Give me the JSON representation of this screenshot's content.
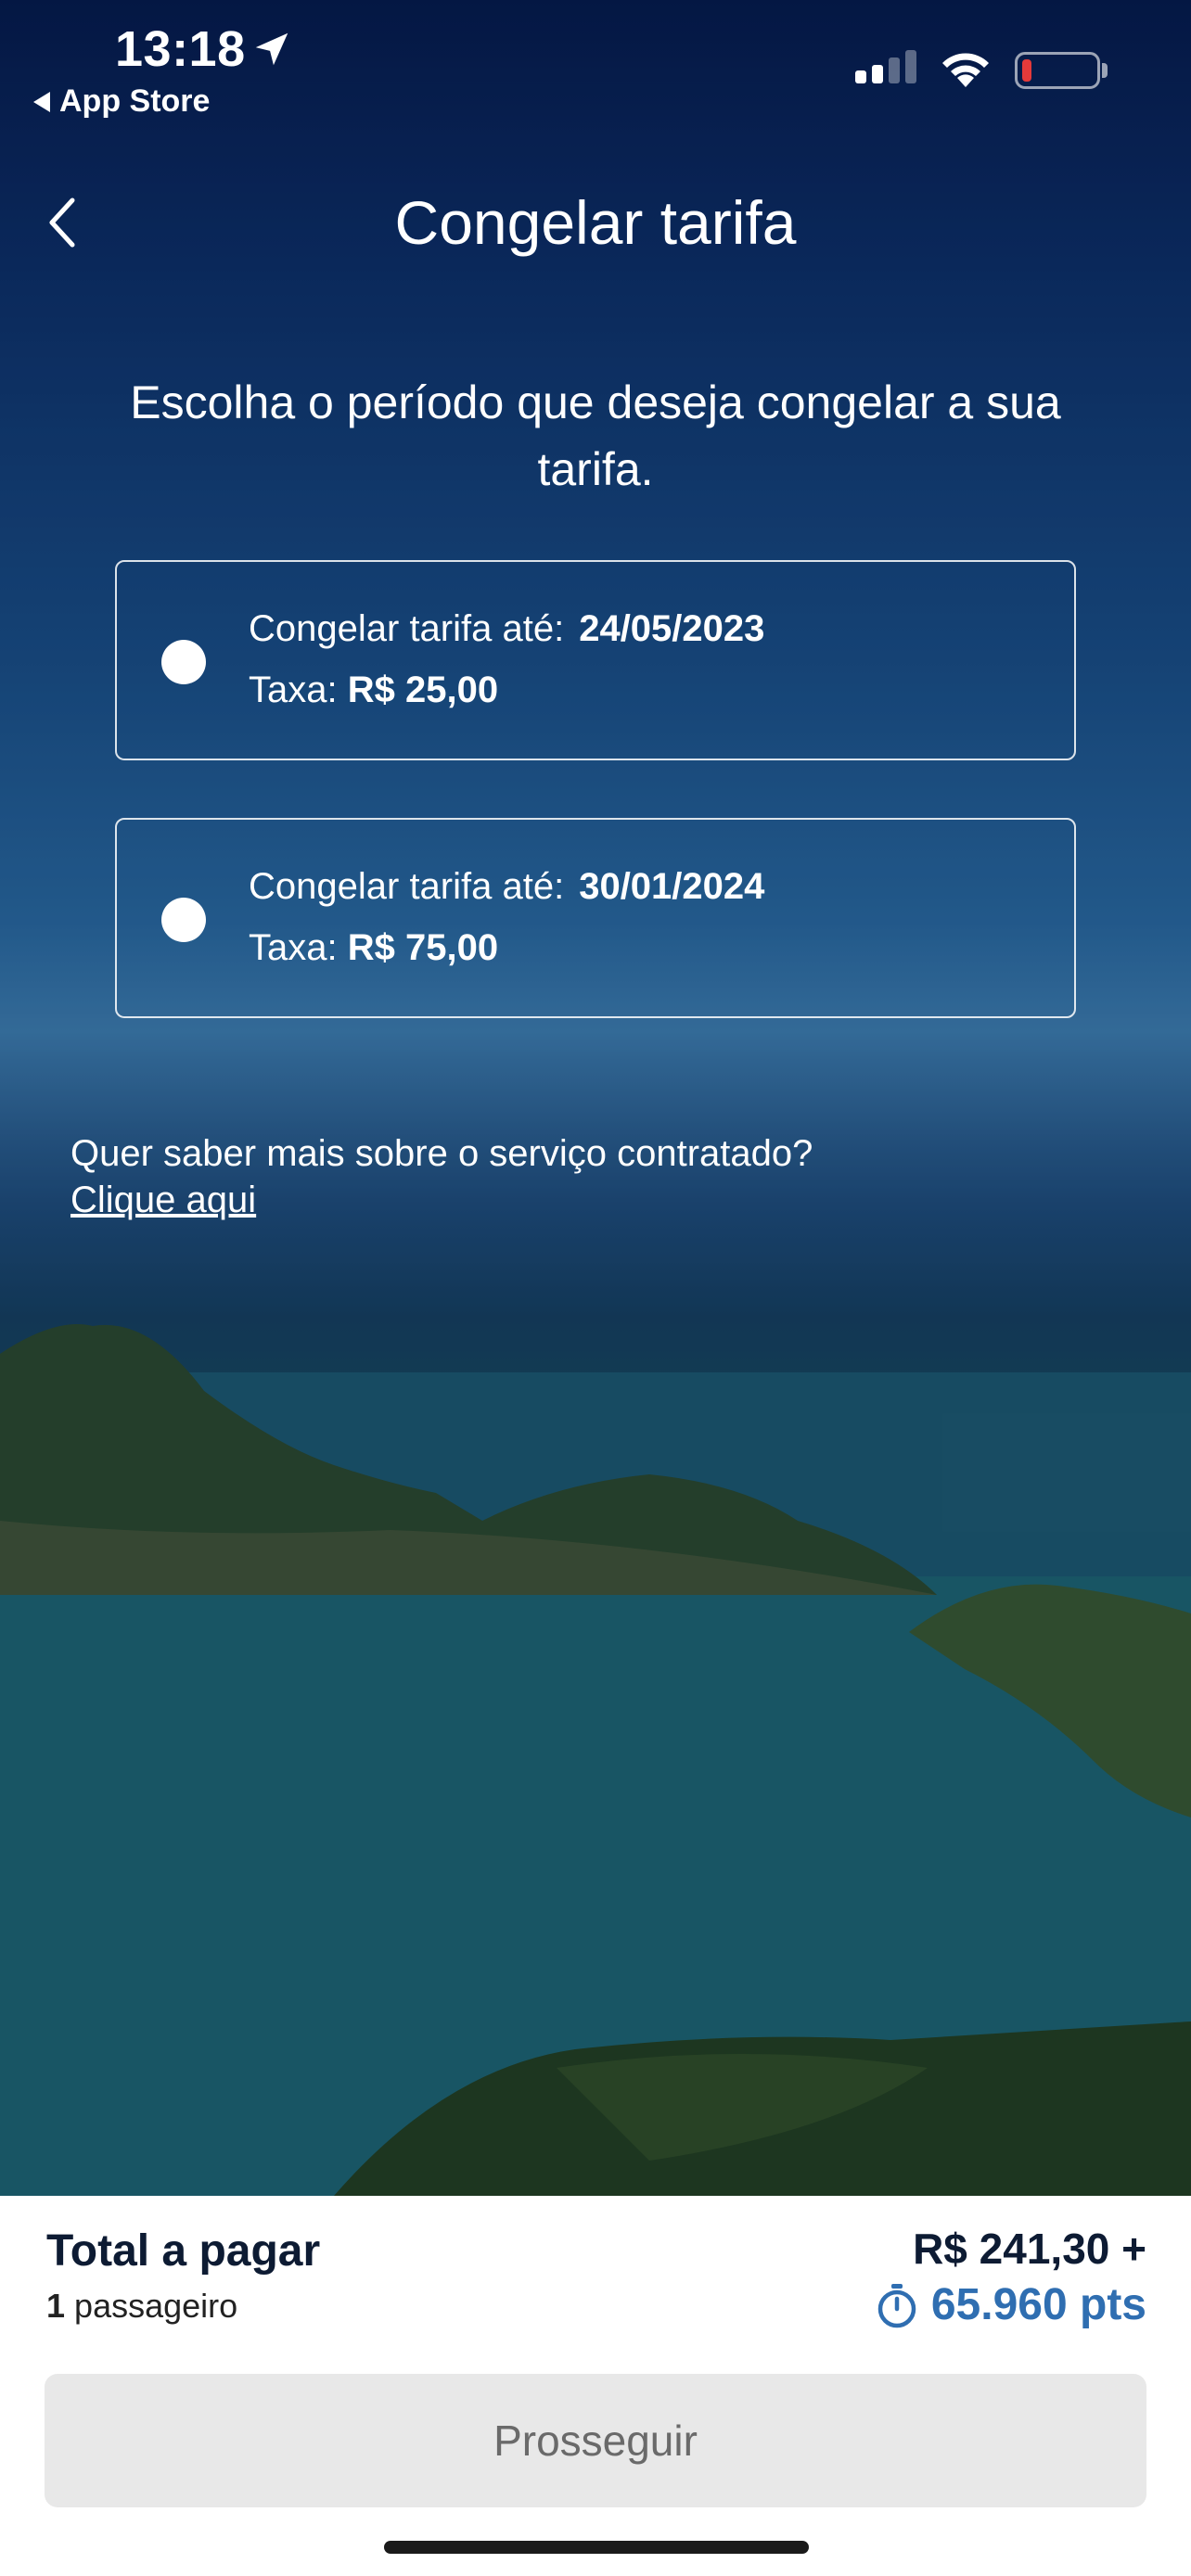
{
  "status_bar": {
    "time": "13:18",
    "back_app": "App Store",
    "battery_color": "#e53a3a"
  },
  "header": {
    "title": "Congelar tarifa"
  },
  "instruction": "Escolha o período que deseja congelar a sua tarifa.",
  "options": [
    {
      "label": "Congelar tarifa até:",
      "date": "24/05/2023",
      "fee_label": "Taxa:",
      "fee": "R$ 25,00",
      "selected": false
    },
    {
      "label": "Congelar tarifa até:",
      "date": "30/01/2024",
      "fee_label": "Taxa:",
      "fee": "R$ 75,00",
      "selected": false
    }
  ],
  "info": {
    "question": "Quer saber mais sobre o serviço contratado?",
    "link": "Clique aqui"
  },
  "footer": {
    "total_label": "Total a pagar",
    "passenger_count": "1",
    "passenger_label": "passageiro",
    "price": "R$ 241,30 +",
    "points": "65.960 pts",
    "points_color": "#2f6eb1",
    "proceed_label": "Prosseguir"
  }
}
